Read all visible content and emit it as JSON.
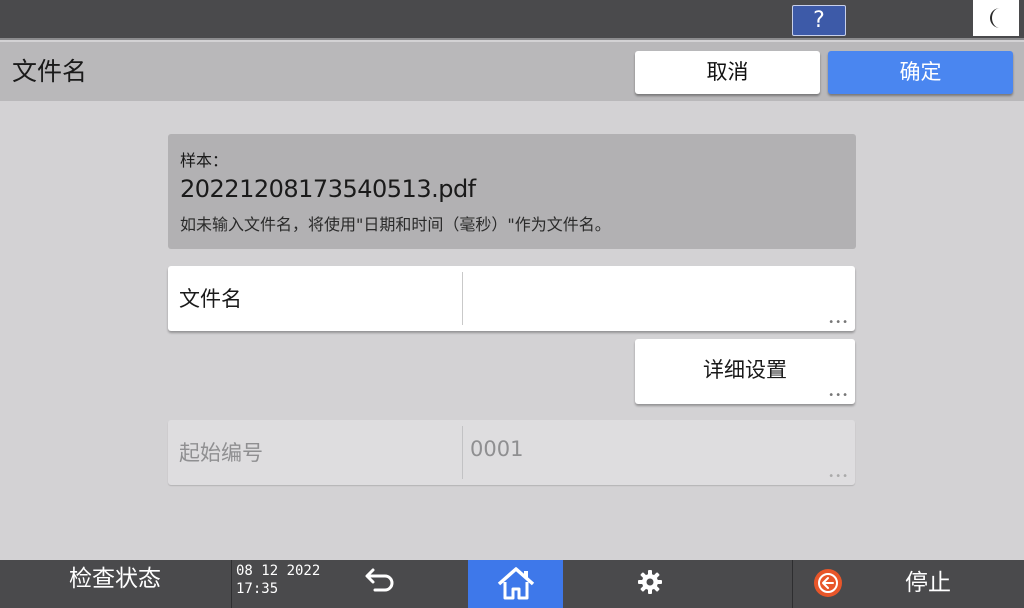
{
  "topbar": {
    "help_label": "?",
    "night_icon": "moon-icon"
  },
  "header": {
    "title": "文件名",
    "cancel_label": "取消",
    "ok_label": "确定"
  },
  "sample": {
    "label": "样本：",
    "value": "20221208173540513.pdf",
    "note": "如未输入文件名，将使用\"日期和时间（毫秒）\"作为文件名。"
  },
  "filename_field": {
    "label": "文件名",
    "value": ""
  },
  "detail_button": {
    "label": "详细设置"
  },
  "start_number_field": {
    "label": "起始编号",
    "value": "0001"
  },
  "bottombar": {
    "status_label": "检查状态",
    "date": "08 12 2022",
    "time": "17:35",
    "back_icon": "back-arrow-icon",
    "home_icon": "home-icon",
    "settings_icon": "gear-icon",
    "stop_icon": "stop-icon",
    "stop_label": "停止"
  },
  "colors": {
    "accent": "#4a86f0",
    "home_active": "#3e78ea",
    "stop": "#e8562a"
  }
}
